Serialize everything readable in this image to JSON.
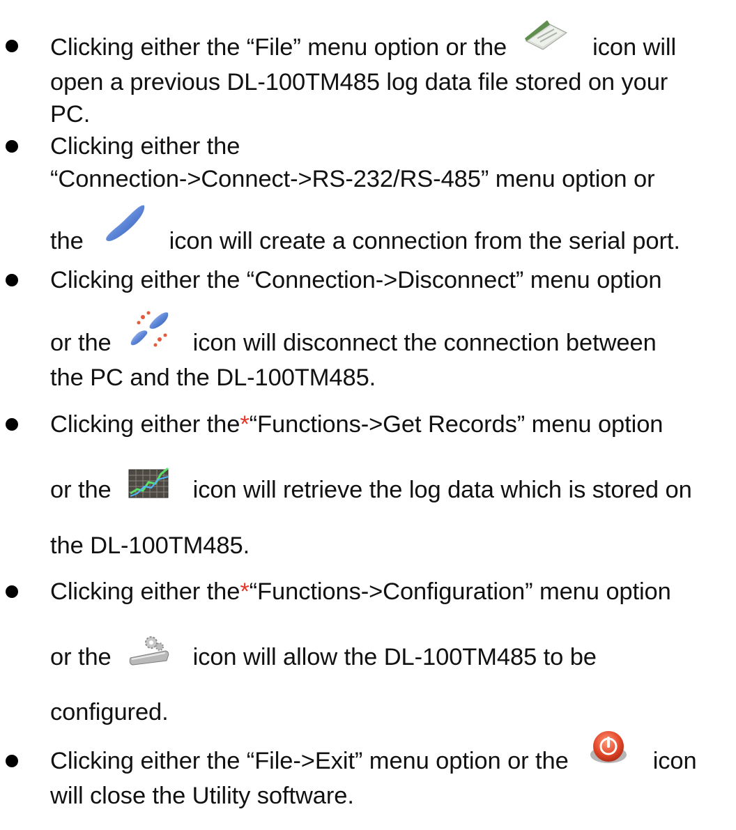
{
  "items": [
    {
      "line1": {
        "pre": "Clicking either the “File” menu option or the",
        "post": "icon will"
      },
      "line2": "open a previous DL-100TM485 log data file stored on your",
      "line3": "PC.",
      "icon": "open-file-icon"
    },
    {
      "line1": "Clicking either the",
      "line2": "“Connection->Connect->RS-232/RS-485” menu option or",
      "line3": {
        "pre": "the",
        "post": "icon will create a connection from the serial port."
      },
      "icon": "connect-plug-icon"
    },
    {
      "line1": "Clicking either the “Connection->Disconnect” menu option",
      "line2": {
        "pre": "or the",
        "post": "icon will disconnect the connection between"
      },
      "line3": "the PC and the DL-100TM485.",
      "icon": "disconnect-plug-icon"
    },
    {
      "line1": {
        "pre": "Clicking either the",
        "star": "*",
        "post": "“Functions->Get Records” menu option"
      },
      "line2": {
        "pre": "or the",
        "post": "icon will retrieve the log data which is stored on"
      },
      "line3": "the DL-100TM485.",
      "icon": "get-records-chart-icon"
    },
    {
      "line1": {
        "pre": "Clicking either the",
        "star": "*",
        "post": "“Functions->Configuration” menu option"
      },
      "line2": {
        "pre": "or the",
        "post": "icon will allow the DL-100TM485 to be"
      },
      "line3": "configured.",
      "icon": "configuration-gear-icon"
    },
    {
      "line1": {
        "pre": "Clicking either the “File->Exit” menu option or the",
        "post": "icon"
      },
      "line2": "will close the Utility software.",
      "icon": "exit-power-icon"
    }
  ],
  "colors": {
    "text": "#111111",
    "star": "#e8352a",
    "bullet": "#000000"
  }
}
